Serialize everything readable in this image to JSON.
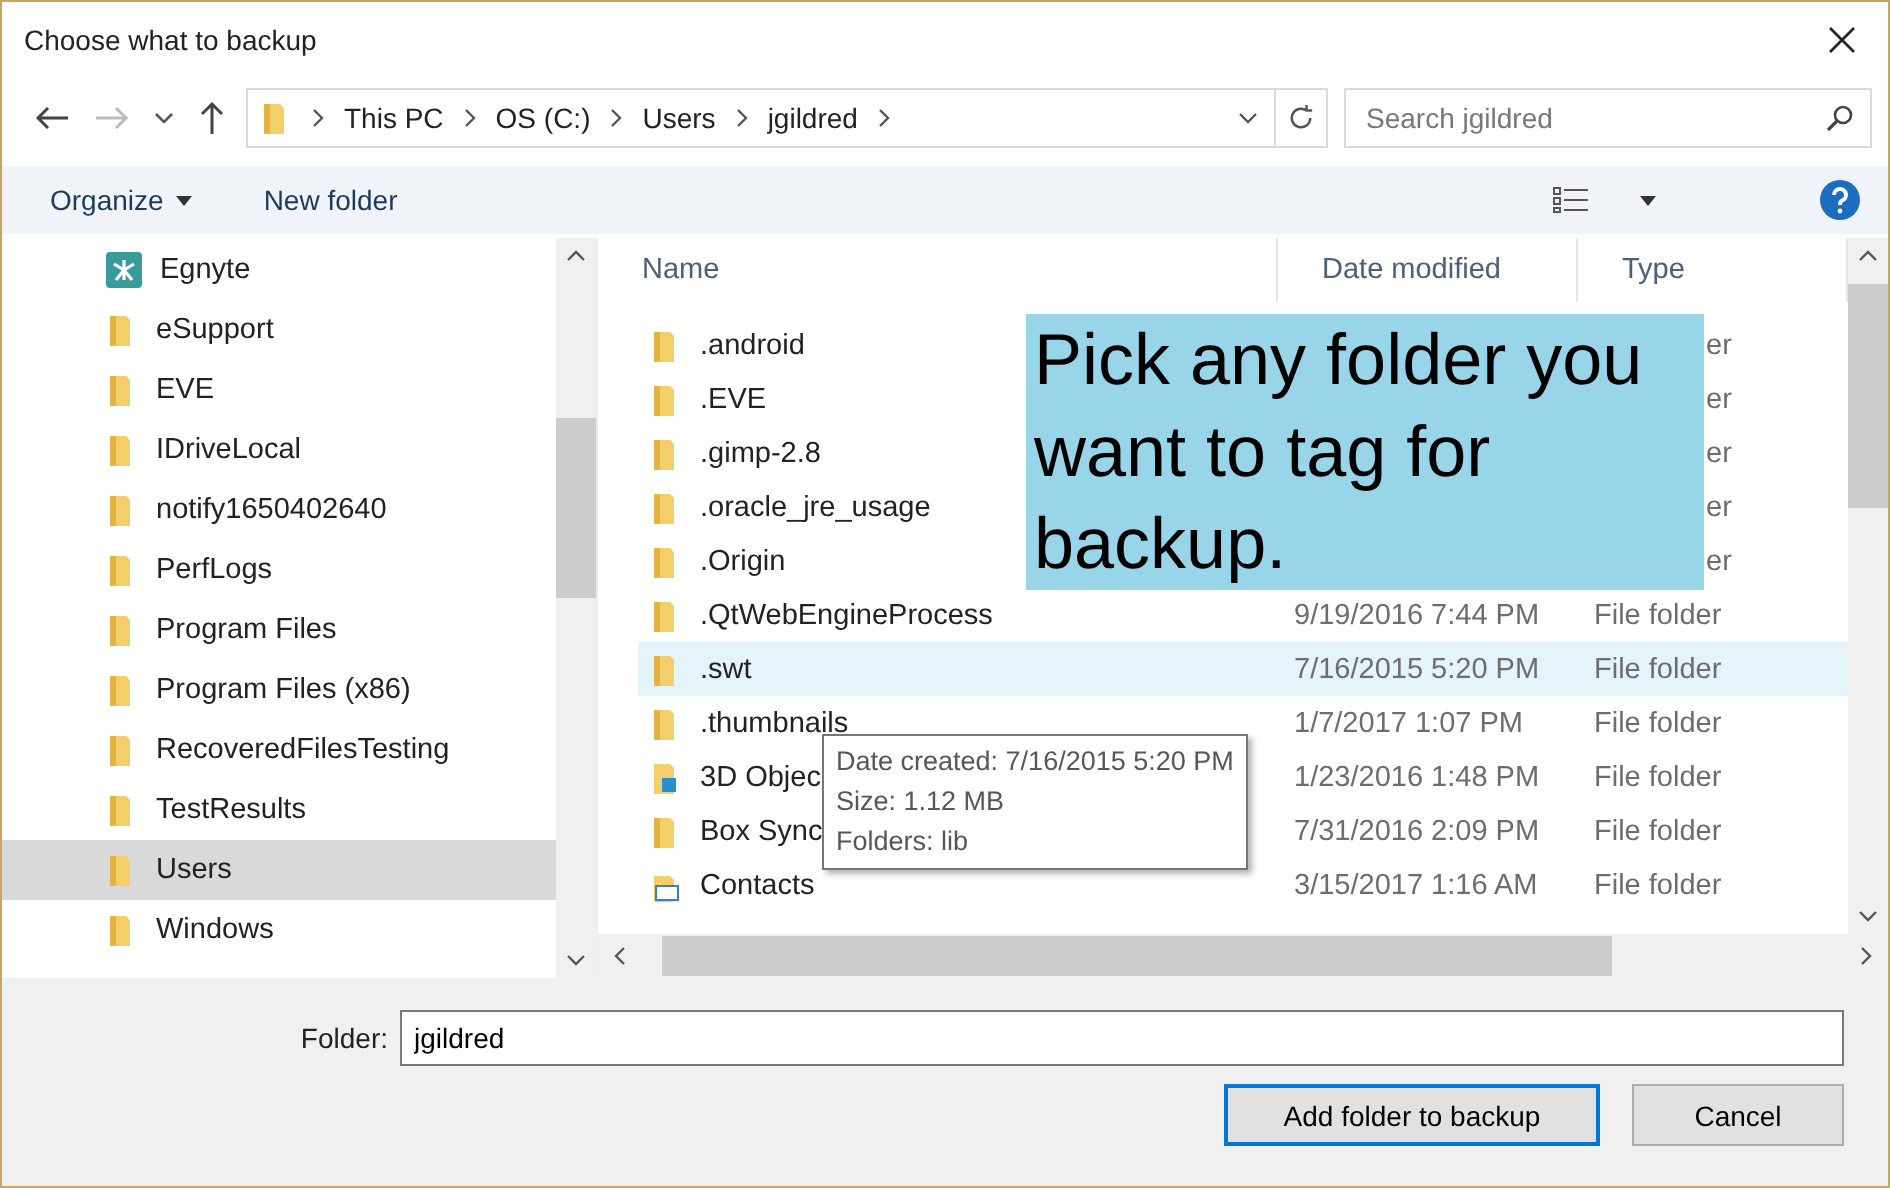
{
  "window": {
    "title": "Choose what to backup"
  },
  "breadcrumb": [
    "This PC",
    "OS (C:)",
    "Users",
    "jgildred"
  ],
  "search": {
    "placeholder": "Search jgildred"
  },
  "toolbar": {
    "organize": "Organize",
    "new_folder": "New folder"
  },
  "sidebar": {
    "items": [
      {
        "name": "Egnyte",
        "kind": "app",
        "selected": false
      },
      {
        "name": "eSupport",
        "kind": "folder",
        "selected": false
      },
      {
        "name": "EVE",
        "kind": "folder",
        "selected": false
      },
      {
        "name": "IDriveLocal",
        "kind": "folder",
        "selected": false
      },
      {
        "name": "notify1650402640",
        "kind": "folder",
        "selected": false
      },
      {
        "name": "PerfLogs",
        "kind": "folder",
        "selected": false
      },
      {
        "name": "Program Files",
        "kind": "folder",
        "selected": false
      },
      {
        "name": "Program Files (x86)",
        "kind": "folder",
        "selected": false
      },
      {
        "name": "RecoveredFilesTesting",
        "kind": "folder",
        "selected": false
      },
      {
        "name": "TestResults",
        "kind": "folder",
        "selected": false
      },
      {
        "name": "Users",
        "kind": "folder",
        "selected": true
      },
      {
        "name": "Windows",
        "kind": "folder",
        "selected": false
      }
    ]
  },
  "table": {
    "columns": [
      "Name",
      "Date modified",
      "Type"
    ],
    "rows": [
      {
        "name": ".android",
        "type": "er",
        "kind": "folder",
        "selected": false
      },
      {
        "name": ".EVE",
        "type": "er",
        "kind": "folder",
        "selected": false
      },
      {
        "name": ".gimp-2.8",
        "type": "er",
        "kind": "folder",
        "selected": false
      },
      {
        "name": ".oracle_jre_usage",
        "type": "er",
        "kind": "folder",
        "selected": false
      },
      {
        "name": ".Origin",
        "type": "er",
        "kind": "folder",
        "selected": false
      },
      {
        "name": ".QtWebEngineProcess",
        "date": "9/19/2016 7:44 PM",
        "type": "File folder",
        "kind": "folder",
        "selected": false
      },
      {
        "name": ".swt",
        "date": "7/16/2015 5:20 PM",
        "type": "File folder",
        "kind": "folder",
        "selected": true
      },
      {
        "name": ".thumbnails",
        "date": "1/7/2017 1:07 PM",
        "type": "File folder",
        "kind": "folder",
        "selected": false
      },
      {
        "name": "3D Objec",
        "date": "1/23/2016 1:48 PM",
        "type": "File folder",
        "kind": "objects",
        "selected": false
      },
      {
        "name": "Box Sync",
        "date": "7/31/2016 2:09 PM",
        "type": "File folder",
        "kind": "folder",
        "selected": false
      },
      {
        "name": "Contacts",
        "date": "3/15/2017 1:16 AM",
        "type": "File folder",
        "kind": "contacts",
        "selected": false
      }
    ]
  },
  "tooltip": [
    "Date created: 7/16/2015 5:20 PM",
    "Size: 1.12 MB",
    "Folders: lib"
  ],
  "callout": "Pick any folder you want to tag for backup.",
  "folder_field": {
    "label": "Folder:",
    "value": "jgildred"
  },
  "buttons": [
    {
      "label": "Add folder to backup",
      "kind": "primary"
    },
    {
      "label": "Cancel",
      "kind": "normal"
    }
  ]
}
